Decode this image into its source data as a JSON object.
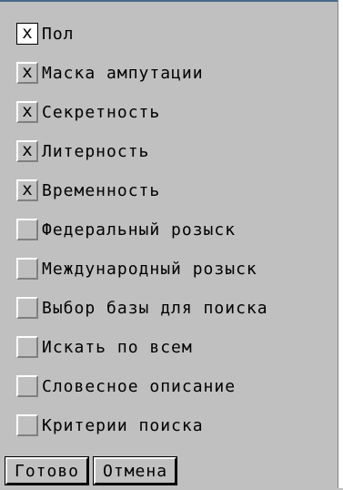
{
  "options": [
    {
      "label": "Пол",
      "checked": true
    },
    {
      "label": "Маска ампутации",
      "checked": true
    },
    {
      "label": "Секретность",
      "checked": true
    },
    {
      "label": "Литерность",
      "checked": true
    },
    {
      "label": "Временность",
      "checked": true
    },
    {
      "label": "Федеральный розыск",
      "checked": false
    },
    {
      "label": "Международный розыск",
      "checked": false
    },
    {
      "label": "Выбор базы для поиска",
      "checked": false
    },
    {
      "label": "Искать по всем",
      "checked": false
    },
    {
      "label": "Словесное описание",
      "checked": false
    },
    {
      "label": "Критерии поиска",
      "checked": false
    }
  ],
  "check_mark": "x",
  "buttons": {
    "ok_label": "Готово",
    "cancel_label": "Отмена"
  }
}
